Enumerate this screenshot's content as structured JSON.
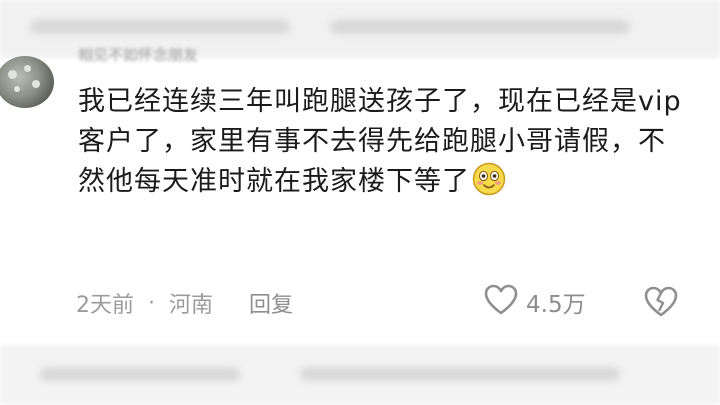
{
  "comment": {
    "username": "相见不如怀念朋友",
    "text": "我已经连续三年叫跑腿送孩子了，现在已经是vip客户了，家里有事不去得先给跑腿小哥请假，不然他每天准时就在我家楼下等了",
    "emoji": "smiling-face-emoji",
    "time": "2天前",
    "separator": "·",
    "location": "河南",
    "reply_label": "回复",
    "like_count": "4.5万"
  },
  "colors": {
    "text": "#1b1b1b",
    "meta": "#9b9b9b",
    "emoji_fill": "#f7d94c"
  }
}
